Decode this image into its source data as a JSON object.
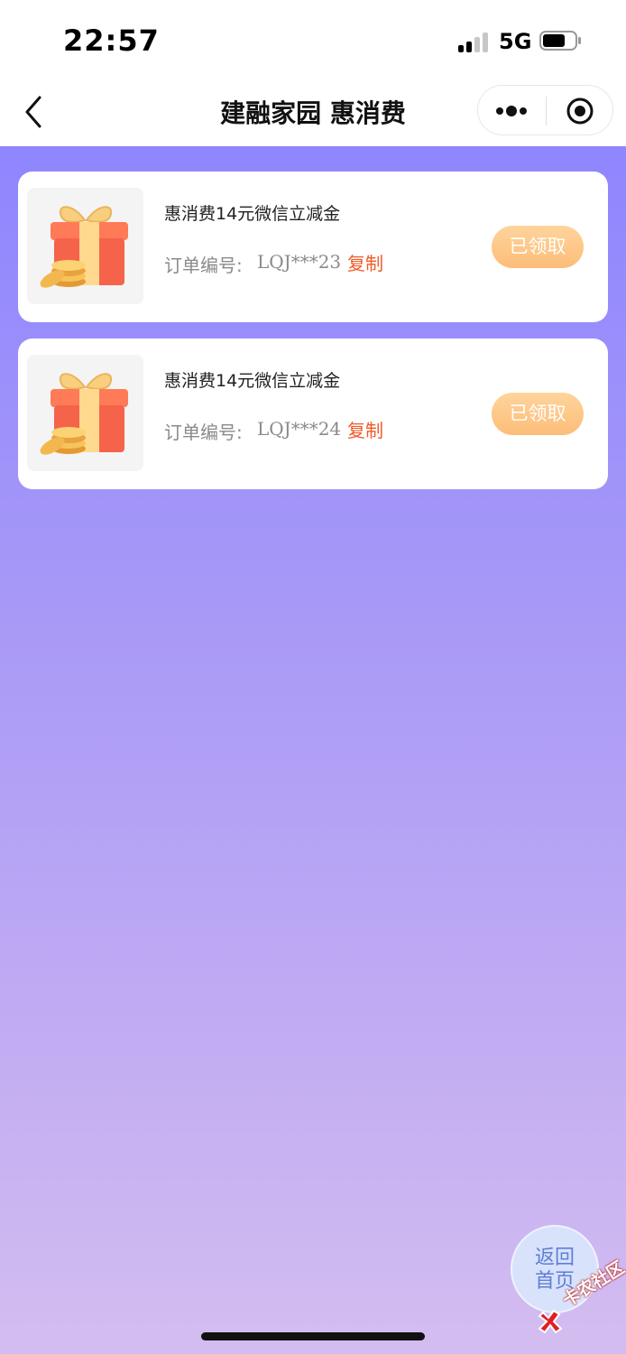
{
  "status_bar": {
    "time": "22:57",
    "network": "5G",
    "icons": [
      "signal-icon",
      "battery-icon"
    ]
  },
  "nav": {
    "title": "建融家园 惠消费",
    "icons": [
      "back-icon",
      "more-icon",
      "target-icon"
    ]
  },
  "orders": [
    {
      "title": "惠消费14元微信立减金",
      "order_label": "订单编号:",
      "order_number": "LQJ***23",
      "copy_label": "复制",
      "status_label": "已领取"
    },
    {
      "title": "惠消费14元微信立减金",
      "order_label": "订单编号:",
      "order_number": "LQJ***24",
      "copy_label": "复制",
      "status_label": "已领取"
    }
  ],
  "home_button": {
    "line1": "返回",
    "line2": "首页"
  },
  "watermark": {
    "text": "卡农社区"
  },
  "colors": {
    "background_top": "#8f86ff",
    "background_bottom": "#d3bdf0",
    "copy_link": "#f05a28",
    "claimed_button": "#fcbd78",
    "home_button": "#d9e2fb"
  }
}
